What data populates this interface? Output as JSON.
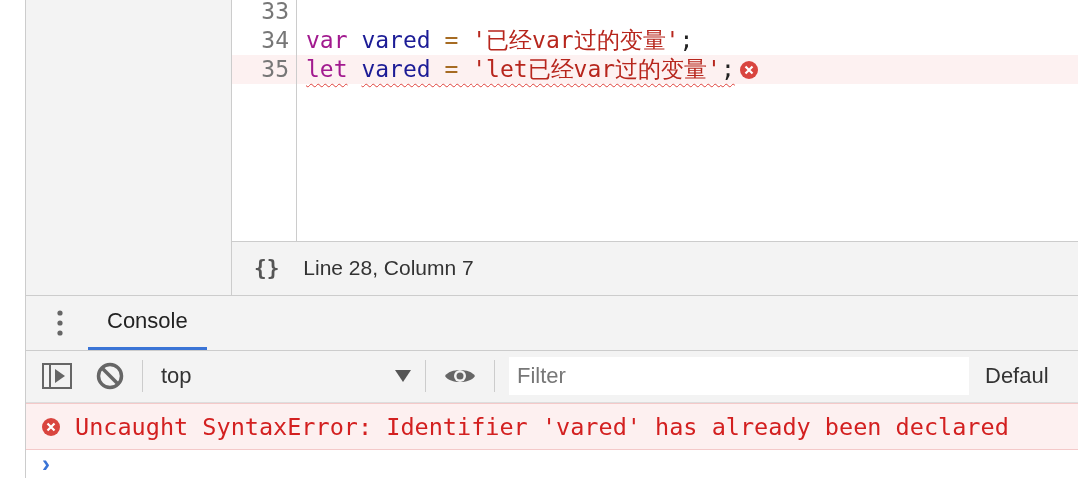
{
  "editor": {
    "lines": [
      {
        "number": "33",
        "error": false
      },
      {
        "number": "34",
        "error": false,
        "tokens": [
          {
            "kind": "keyword",
            "text": "var"
          },
          {
            "kind": "variable",
            "text": "vared"
          },
          {
            "kind": "operator",
            "text": " = "
          },
          {
            "kind": "string",
            "text": "'已经var过的变量'"
          },
          {
            "kind": "plain",
            "text": ";"
          }
        ]
      },
      {
        "number": "35",
        "error": true,
        "tokens": [
          {
            "kind": "keyword",
            "text": "let"
          },
          {
            "kind": "variable",
            "text": "vared"
          },
          {
            "kind": "operator",
            "text": " = "
          },
          {
            "kind": "string",
            "text": "'let已经var过的变量'"
          },
          {
            "kind": "plain",
            "text": ";"
          }
        ]
      }
    ]
  },
  "status_bar": {
    "format_icon": "{}",
    "position": "Line 28, Column 7"
  },
  "drawer": {
    "tabs": [
      {
        "label": "Console",
        "selected": true
      }
    ]
  },
  "toolbar": {
    "context": "top",
    "filter": {
      "placeholder": "Filter"
    },
    "levels": "Defaul"
  },
  "messages": [
    {
      "kind": "error",
      "text": "Uncaught SyntaxError: Identifier 'vared' has already been declared"
    }
  ],
  "prompt": "›"
}
